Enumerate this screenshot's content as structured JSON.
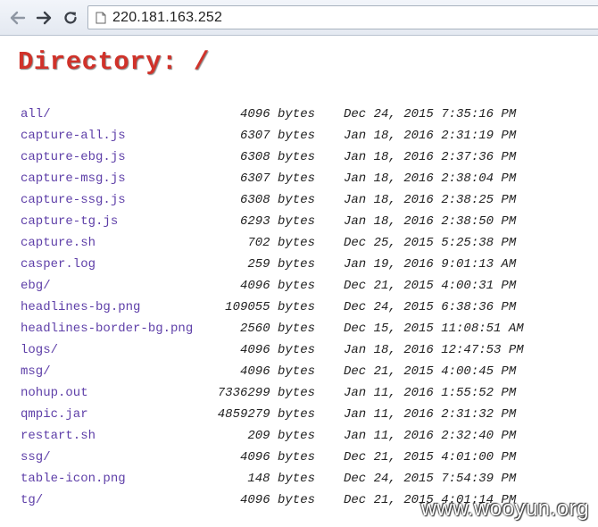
{
  "browser": {
    "url": "220.181.163.252",
    "icons": {
      "back": "arrow-left-icon",
      "forward": "arrow-right-icon",
      "reload": "reload-icon",
      "page": "page-icon"
    }
  },
  "page": {
    "heading": "Directory: /",
    "colors": {
      "heading": "#d0322a",
      "link": "#5e3fa8"
    }
  },
  "files": [
    {
      "name": "all/",
      "size": "4096 bytes",
      "date": "Dec 24, 2015 7:35:16 PM"
    },
    {
      "name": "capture-all.js",
      "size": "6307 bytes",
      "date": "Jan 18, 2016 2:31:19 PM"
    },
    {
      "name": "capture-ebg.js",
      "size": "6308 bytes",
      "date": "Jan 18, 2016 2:37:36 PM"
    },
    {
      "name": "capture-msg.js",
      "size": "6307 bytes",
      "date": "Jan 18, 2016 2:38:04 PM"
    },
    {
      "name": "capture-ssg.js",
      "size": "6308 bytes",
      "date": "Jan 18, 2016 2:38:25 PM"
    },
    {
      "name": "capture-tg.js",
      "size": "6293 bytes",
      "date": "Jan 18, 2016 2:38:50 PM"
    },
    {
      "name": "capture.sh",
      "size": "702 bytes",
      "date": "Dec 25, 2015 5:25:38 PM"
    },
    {
      "name": "casper.log",
      "size": "259 bytes",
      "date": "Jan 19, 2016 9:01:13 AM"
    },
    {
      "name": "ebg/",
      "size": "4096 bytes",
      "date": "Dec 21, 2015 4:00:31 PM"
    },
    {
      "name": "headlines-bg.png",
      "size": "109055 bytes",
      "date": "Dec 24, 2015 6:38:36 PM"
    },
    {
      "name": "headlines-border-bg.png",
      "size": "2560 bytes",
      "date": "Dec 15, 2015 11:08:51 AM"
    },
    {
      "name": "logs/",
      "size": "4096 bytes",
      "date": "Jan 18, 2016 12:47:53 PM"
    },
    {
      "name": "msg/",
      "size": "4096 bytes",
      "date": "Dec 21, 2015 4:00:45 PM"
    },
    {
      "name": "nohup.out",
      "size": "7336299 bytes",
      "date": "Jan 11, 2016 1:55:52 PM"
    },
    {
      "name": "qmpic.jar",
      "size": "4859279 bytes",
      "date": "Jan 11, 2016 2:31:32 PM"
    },
    {
      "name": "restart.sh",
      "size": "209 bytes",
      "date": "Jan 11, 2016 2:32:40 PM"
    },
    {
      "name": "ssg/",
      "size": "4096 bytes",
      "date": "Dec 21, 2015 4:01:00 PM"
    },
    {
      "name": "table-icon.png",
      "size": "148 bytes",
      "date": "Dec 24, 2015 7:54:39 PM"
    },
    {
      "name": "tg/",
      "size": "4096 bytes",
      "date": "Dec 21, 2015 4:01:14 PM"
    }
  ],
  "watermark": "www.wooyun.org"
}
